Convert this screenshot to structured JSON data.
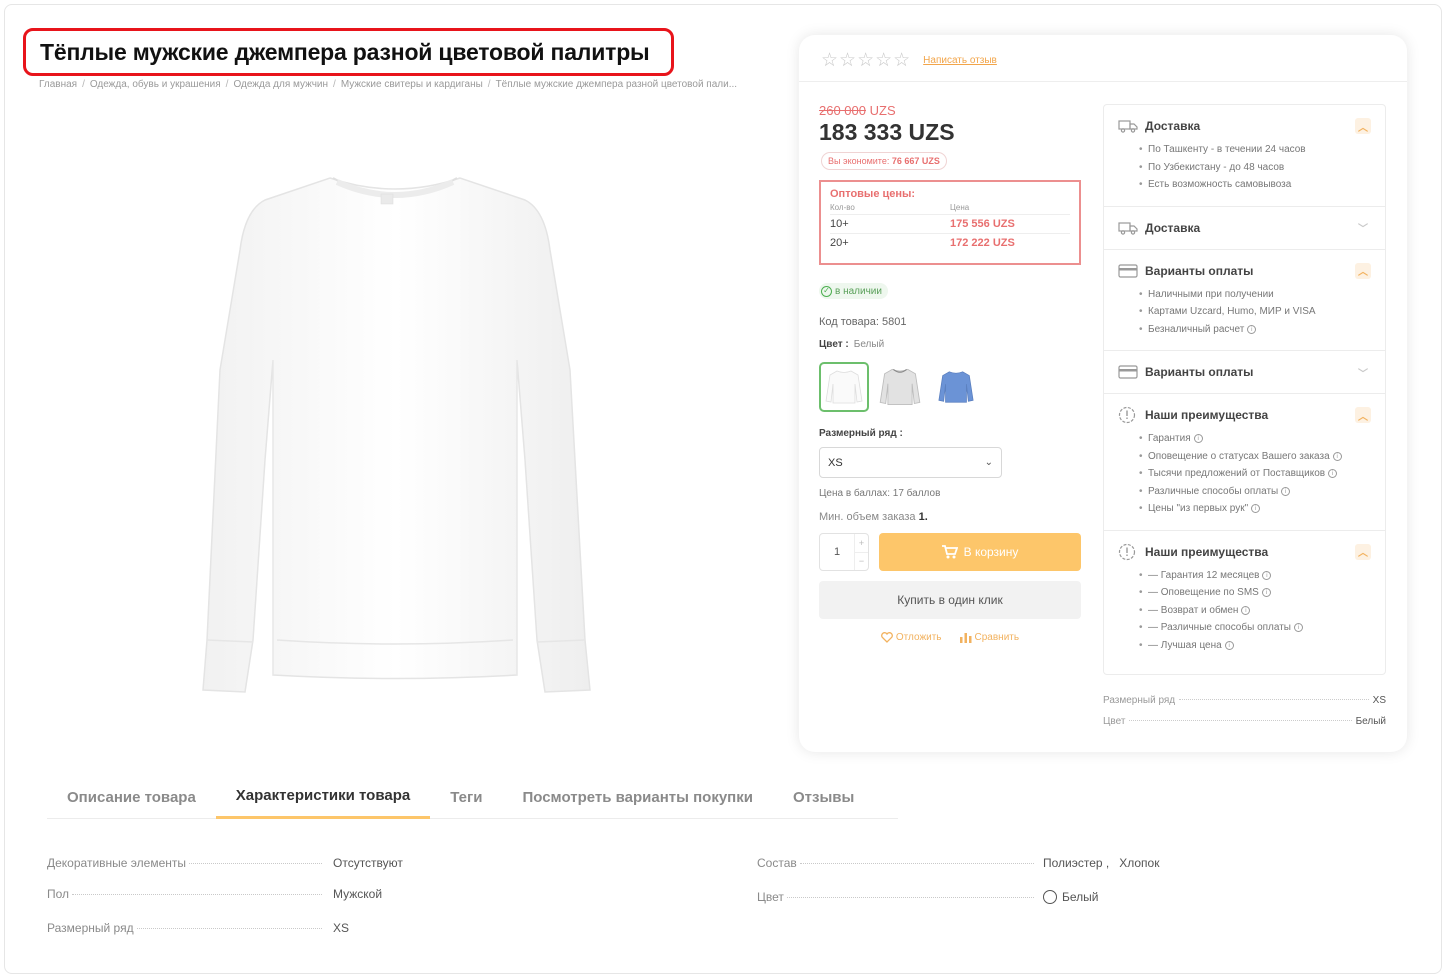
{
  "product": {
    "title": "Тёплые мужские джемпера разной цветовой палитры",
    "breadcrumb": [
      "Главная",
      "Одежда, обувь и украшения",
      "Одежда для мужчин",
      "Мужские свитеры и кардиганы",
      "Тёплые мужские джемпера разной цветовой пали..."
    ],
    "image_icon": "white-sweater-image"
  },
  "rating": {
    "stars": "☆☆☆☆☆",
    "write_review": "Написать отзыв",
    "value": 0,
    "max": 5
  },
  "price": {
    "old_value": "260 000",
    "old_currency": "UZS",
    "new": "183 333 UZS",
    "save_label": "Вы экономите:",
    "save_value": "76 667 UZS"
  },
  "wholesale": {
    "title": "Оптовые цены:",
    "col_qty": "Кол-во",
    "col_price": "Цена",
    "rows": [
      {
        "qty": "10+",
        "price": "175 556 UZS"
      },
      {
        "qty": "20+",
        "price": "172 222 UZS"
      }
    ]
  },
  "stock": {
    "label": "в наличии"
  },
  "sku": {
    "text": "Код товара: 5801"
  },
  "color": {
    "label": "Цвет :",
    "value": "Белый",
    "swatches": [
      {
        "name": "white",
        "color": "#ffffff",
        "selected": true
      },
      {
        "name": "grey",
        "color": "#dcdcdc",
        "selected": false
      },
      {
        "name": "blue",
        "color": "#6b93d6",
        "selected": false
      }
    ]
  },
  "size": {
    "label": "Размерный ряд :",
    "selected": "XS"
  },
  "points": {
    "text": "Цена в баллах: 17 баллов"
  },
  "min_order": {
    "label": "Мин. объем заказа",
    "value": "1."
  },
  "qty": {
    "value": "1",
    "plus": "+",
    "minus": "−"
  },
  "buttons": {
    "cart": "В корзину",
    "buy_one": "Купить в один клик",
    "defer": "Отложить",
    "compare": "Сравнить"
  },
  "info": {
    "sections": [
      {
        "title": "Доставка",
        "icon": "truck-icon",
        "open": true,
        "items": [
          {
            "text": "По Ташкенту - в течении 24 часов",
            "info": false
          },
          {
            "text": "По Узбекистану - до 48 часов",
            "info": false
          },
          {
            "text": "Есть возможность самовывоза",
            "info": false
          }
        ]
      },
      {
        "title": "Доставка",
        "icon": "truck-icon",
        "open": false,
        "items": []
      },
      {
        "title": "Варианты оплаты",
        "icon": "card-icon",
        "open": true,
        "items": [
          {
            "text": "Наличными при получении",
            "info": false
          },
          {
            "text": "Картами Uzcard, Humo, МИР и VISA",
            "info": false
          },
          {
            "text": "Безналичный расчет",
            "info": true
          }
        ]
      },
      {
        "title": "Варианты оплаты",
        "icon": "card-icon",
        "open": false,
        "items": []
      },
      {
        "title": "Наши преимущества",
        "icon": "badge-icon",
        "open": true,
        "items": [
          {
            "text": "Гарантия",
            "info": true
          },
          {
            "text": "Оповещение о статусах Вашего заказа",
            "info": true
          },
          {
            "text": "Тысячи предложений от Поставщиков",
            "info": true
          },
          {
            "text": "Различные способы оплаты",
            "info": true
          },
          {
            "text": "Цены \"из первых рук\"",
            "info": true
          }
        ]
      },
      {
        "title": "Наши преимущества",
        "icon": "badge-icon",
        "open": true,
        "items": [
          {
            "text": "— Гарантия 12 месяцев",
            "info": true
          },
          {
            "text": "— Оповещение по SMS",
            "info": true
          },
          {
            "text": "— Возврат и обмен",
            "info": true
          },
          {
            "text": "— Различные способы оплаты",
            "info": true
          },
          {
            "text": "— Лучшая цена",
            "info": true
          }
        ]
      }
    ],
    "toggle_open": "^",
    "toggle_closed": "v",
    "info_glyph": "i"
  },
  "mini_specs": [
    {
      "label": "Размерный ряд",
      "value": "XS"
    },
    {
      "label": "Цвет",
      "value": "Белый"
    }
  ],
  "tabs": [
    {
      "label": "Описание товара",
      "active": false
    },
    {
      "label": "Характеристики товара",
      "active": true
    },
    {
      "label": "Теги",
      "active": false
    },
    {
      "label": "Посмотреть варианты покупки",
      "active": false
    },
    {
      "label": "Отзывы",
      "active": false
    }
  ],
  "specs": {
    "left": [
      {
        "label": "Декоративные элементы",
        "value": "Отсутствуют"
      },
      {
        "label": "Пол",
        "value": "Мужской"
      },
      {
        "label": "Размерный ряд",
        "value": "XS"
      }
    ],
    "right": [
      {
        "label": "Состав",
        "value": "Полиэстер ,   Хлопок"
      },
      {
        "label": "Цвет",
        "value": "Белый"
      }
    ]
  },
  "colors": {
    "accent": "#fdc66a",
    "price_red": "#e86f6f",
    "title_border": "#e8141b",
    "in_stock": "#4caf50"
  }
}
